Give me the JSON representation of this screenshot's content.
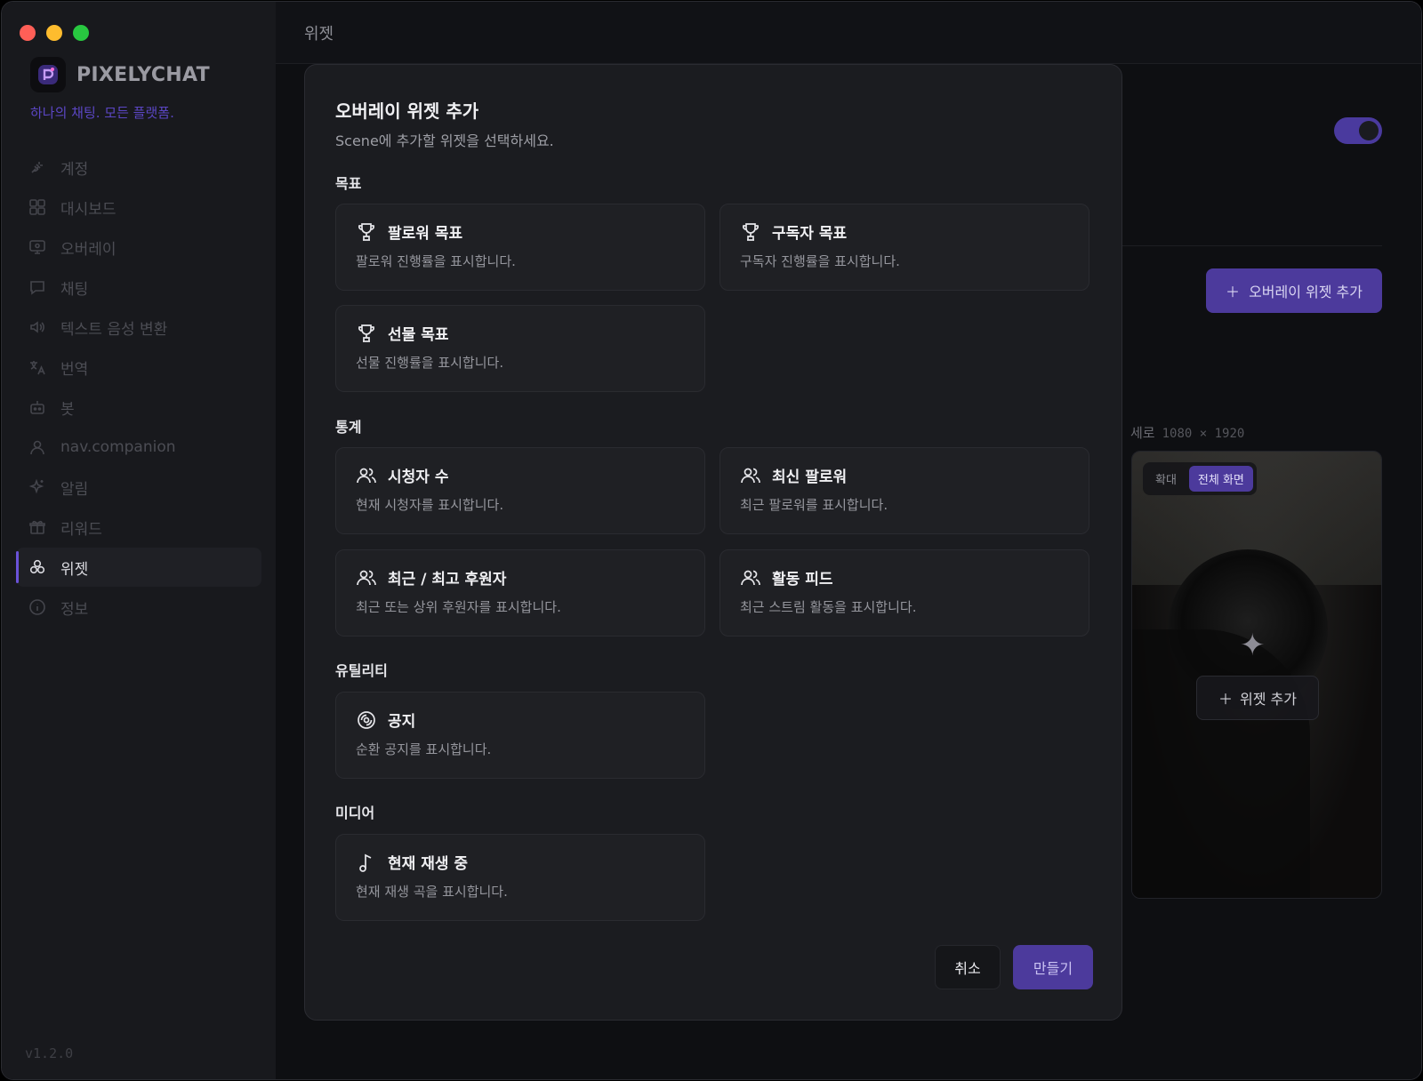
{
  "app": {
    "name": "PIXELYCHAT",
    "tagline": "하나의 채팅. 모든 플랫폼.",
    "version": "v1.2.0",
    "accent": "#4c3a9c"
  },
  "sidebar": {
    "items": [
      {
        "label": "계정",
        "icon": "plug-icon"
      },
      {
        "label": "대시보드",
        "icon": "grid-icon"
      },
      {
        "label": "오버레이",
        "icon": "monitor-icon"
      },
      {
        "label": "채팅",
        "icon": "chat-icon"
      },
      {
        "label": "텍스트 음성 변환",
        "icon": "speaker-icon"
      },
      {
        "label": "번역",
        "icon": "translate-icon"
      },
      {
        "label": "봇",
        "icon": "bot-icon"
      },
      {
        "label": "nav.companion",
        "icon": "user-icon"
      },
      {
        "label": "알림",
        "icon": "sparkle-icon"
      },
      {
        "label": "리워드",
        "icon": "gift-icon"
      },
      {
        "label": "위젯",
        "icon": "widgets-icon",
        "active": true
      },
      {
        "label": "정보",
        "icon": "info-icon"
      }
    ]
  },
  "topbar": {
    "title": "위젯"
  },
  "background": {
    "add_overlay_widget_label": "오버레이 위젯 추가",
    "preview_orientation": "세로",
    "preview_size": "1080 × 1920",
    "segment_zoom": "확대",
    "segment_fullscreen": "전체 화면",
    "add_widget_label": "위젯 추가"
  },
  "modal": {
    "title": "오버레이 위젯 추가",
    "subtitle": "Scene에 추가할 위젯을 선택하세요.",
    "sections": {
      "goals": "목표",
      "stats": "통계",
      "utility": "유틸리티",
      "media": "미디어"
    },
    "cards": {
      "follower_goal": {
        "title": "팔로워 목표",
        "desc": "팔로워 진행률을 표시합니다."
      },
      "subscriber_goal": {
        "title": "구독자 목표",
        "desc": "구독자 진행률을 표시합니다."
      },
      "gift_goal": {
        "title": "선물 목표",
        "desc": "선물 진행률을 표시합니다."
      },
      "viewer_count": {
        "title": "시청자 수",
        "desc": "현재 시청자를 표시합니다."
      },
      "latest_follower": {
        "title": "최신 팔로워",
        "desc": "최근 팔로워를 표시합니다."
      },
      "top_supporter": {
        "title": "최근 / 최고 후원자",
        "desc": "최근 또는 상위 후원자를 표시합니다."
      },
      "activity_feed": {
        "title": "활동 피드",
        "desc": "최근 스트림 활동을 표시합니다."
      },
      "announcement": {
        "title": "공지",
        "desc": "순환 공지를 표시합니다."
      },
      "now_playing": {
        "title": "현재 재생 중",
        "desc": "현재 재생 곡을 표시합니다."
      }
    },
    "cancel_label": "취소",
    "create_label": "만들기"
  }
}
